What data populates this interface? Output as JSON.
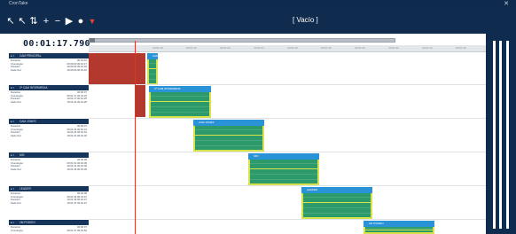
{
  "window": {
    "title": "CronTake",
    "close_icon": "close-icon"
  },
  "toolbar": {
    "document_title": "[ Vacío ]",
    "icons": [
      "marker-in-icon",
      "marker-out-icon",
      "split-icon",
      "add-icon",
      "remove-icon",
      "play-icon",
      "record-icon",
      "dropdown-icon"
    ]
  },
  "timecode": "00:01:17.790",
  "ruler": {
    "ticks": [
      "00:01:18",
      "00:01:20",
      "00:01:22",
      "00:01:24",
      "00:01:26",
      "00:01:28",
      "00:01:30",
      "00:01:32",
      "00:01:34",
      "00:01:36"
    ]
  },
  "tracks": [
    {
      "name": "CAM PRINCIPAL",
      "rows": [
        [
          "Duración",
          "00:01:16"
        ],
        [
          "Cronología",
          "00:00:00 00:01:17"
        ],
        [
          "Posición",
          "10:00:00 00:01:18"
        ],
        [
          "Fade Out",
          "10:00:00 00:01:16"
        ]
      ]
    },
    {
      "name": "2ª CAM INTERMEDIA",
      "rows": [
        [
          "Duración",
          "00:00:07"
        ],
        [
          "Cronología",
          "00:01:17 00:01:24"
        ],
        [
          "Posición",
          "10:01:17 00:01:25"
        ],
        [
          "Fade Out",
          "10:01:24 00:01:25"
        ]
      ]
    },
    {
      "name": "CAM JONES",
      "rows": [
        [
          "Duración",
          "00:00:07"
        ],
        [
          "Cronología",
          "00:01:24 00:01:31"
        ],
        [
          "Posición",
          "10:01:24 00:01:31"
        ],
        [
          "Fade Out",
          "10:01:31 00:01:32"
        ]
      ]
    },
    {
      "name": "MIX",
      "rows": [
        [
          "Duración",
          "00:00:08"
        ],
        [
          "Cronología",
          "00:01:31 00:01:39"
        ],
        [
          "Posición",
          "10:01:31 00:01:39"
        ],
        [
          "Fade Out",
          "10:01:39 00:01:39"
        ]
      ]
    },
    {
      "name": "LEADER",
      "rows": [
        [
          "Duración",
          "00:00:08"
        ],
        [
          "Cronología",
          "00:01:39 00:01:47"
        ],
        [
          "Posición",
          "10:01:39 00:01:47"
        ],
        [
          "Fade Out",
          "10:01:47 00:01:47"
        ]
      ]
    },
    {
      "name": "2M PODEIO",
      "rows": [
        [
          "Duración",
          "00:00:07"
        ],
        [
          "Cronología",
          "00:01:47 00:01:54"
        ]
      ]
    }
  ],
  "clips": [
    {
      "title": "CAM PRINCIPAL"
    },
    {
      "title": "2ª CAM INTERMEDIA"
    },
    {
      "title": "CAM JONES"
    },
    {
      "title": "MIX"
    },
    {
      "title": "LEADER"
    },
    {
      "title": "2M PODEIO"
    }
  ],
  "colors": {
    "chrome": "#0f2b4e",
    "clip_header": "#2a93d8",
    "clip_body": "#2c9a6a",
    "clip_edge": "#d8e24a",
    "cut_region": "#b3392f",
    "playhead": "#d13b2f"
  }
}
